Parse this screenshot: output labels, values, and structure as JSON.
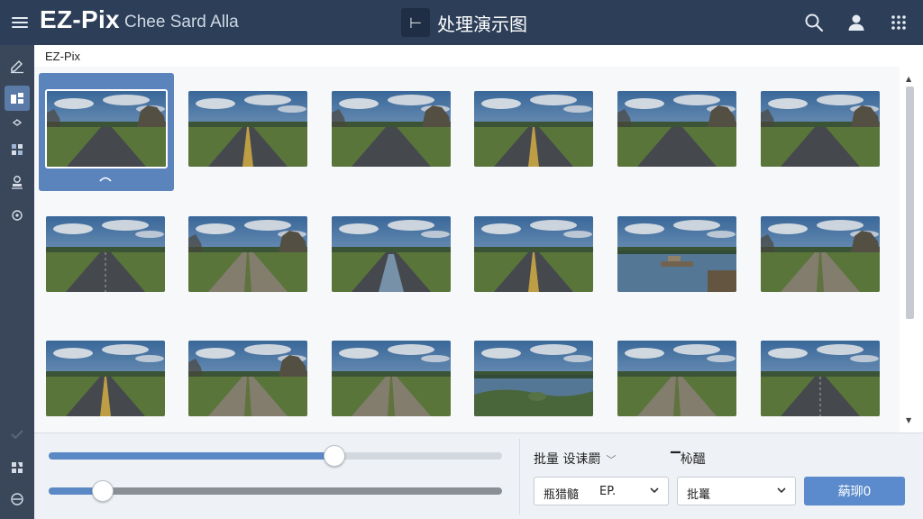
{
  "header": {
    "app_title": "EZ-Pix",
    "app_subtitle": "Chee Sard Alla",
    "back_glyph": "⊢",
    "page_title": "处理演示图",
    "icons": [
      "menu-icon",
      "search-icon",
      "user-icon",
      "apps-grid-icon"
    ]
  },
  "sidebar": {
    "items": [
      {
        "icon": "edit-icon",
        "active": false
      },
      {
        "icon": "layers-icon",
        "active": true
      },
      {
        "icon": "diamond-icon",
        "active": false
      },
      {
        "icon": "puzzle-icon",
        "active": false
      },
      {
        "icon": "stamp-icon",
        "active": false
      },
      {
        "icon": "target-icon",
        "active": false
      },
      {
        "icon": "check-icon",
        "active": false
      },
      {
        "icon": "folder-icon",
        "active": false
      },
      {
        "icon": "swap-icon",
        "active": false
      }
    ]
  },
  "main": {
    "tab_label": "EZ-Pix",
    "selected_index": 0,
    "thumbnails": [
      {
        "scene": "road-rocks"
      },
      {
        "scene": "road-yellow"
      },
      {
        "scene": "road-rocks"
      },
      {
        "scene": "road-yellow"
      },
      {
        "scene": "road-rocks"
      },
      {
        "scene": "road-rocks"
      },
      {
        "scene": "road-plain"
      },
      {
        "scene": "road-dirt-rocks"
      },
      {
        "scene": "road-water"
      },
      {
        "scene": "road-yellow"
      },
      {
        "scene": "lake-dock"
      },
      {
        "scene": "road-dirt-rocks"
      },
      {
        "scene": "road-yellow"
      },
      {
        "scene": "road-grass-rocks"
      },
      {
        "scene": "road-dirt"
      },
      {
        "scene": "river"
      },
      {
        "scene": "road-grass"
      },
      {
        "scene": "road-plain"
      }
    ]
  },
  "controls": {
    "slider1_value": 0.63,
    "slider2_value": 0.12,
    "batch_label": "批量 设诔罽",
    "right_label": "▔杺醞",
    "select1_text": "瓶猎髓",
    "select1_value": "EP.",
    "select2_text": "批鼍",
    "apply_button": "蒳珋0"
  },
  "colors": {
    "header_bg": "#2c3e58",
    "sidebar_bg": "#3a475a",
    "accent": "#5b84bd",
    "button": "#5b8bcc"
  }
}
